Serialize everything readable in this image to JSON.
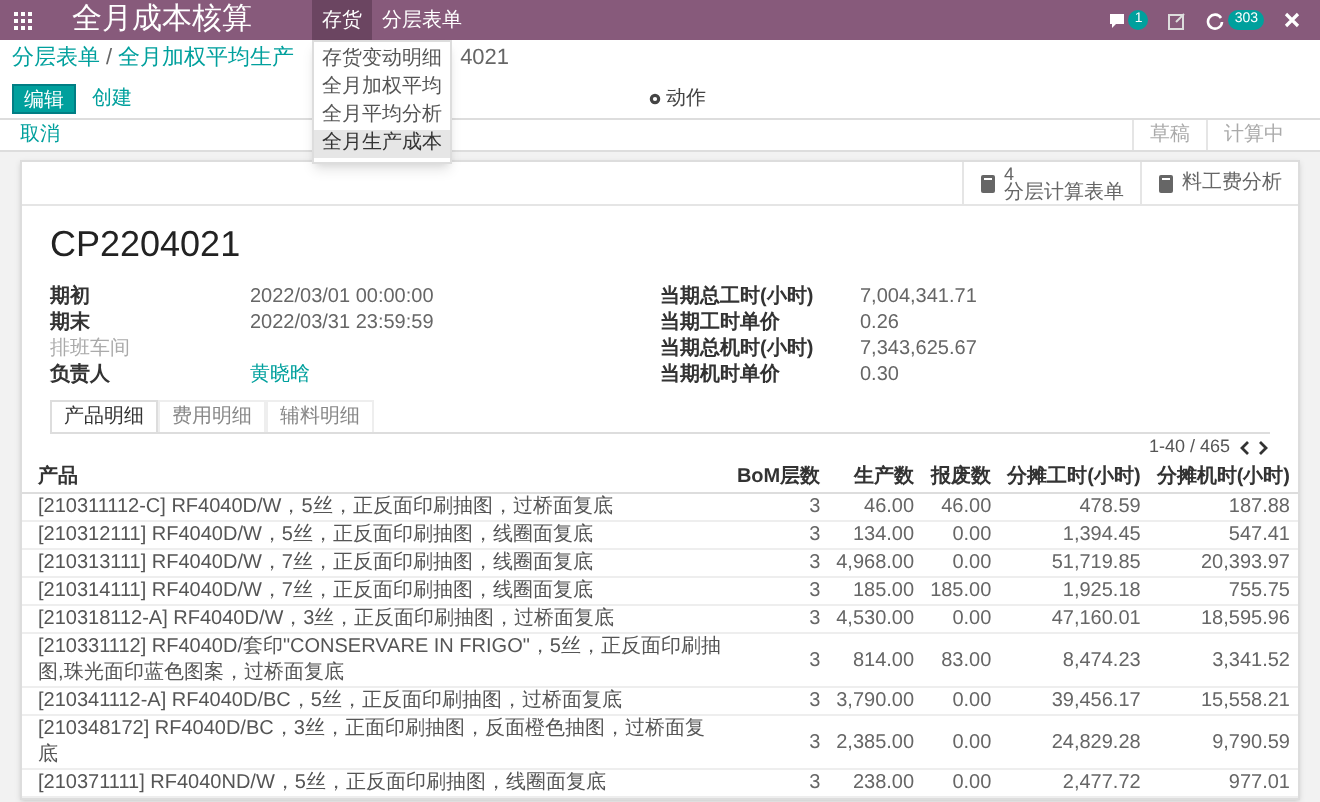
{
  "navbar": {
    "app_title": "全月成本核算",
    "menus": [
      {
        "label": "存货",
        "selected": true
      },
      {
        "label": "分层表单",
        "selected": false
      }
    ],
    "chat_badge": "1",
    "activity_badge": "303"
  },
  "dropdown": {
    "items": [
      {
        "label": "存货变动明细",
        "selected": false
      },
      {
        "label": "全月加权平均",
        "selected": false
      },
      {
        "label": "全月平均分析",
        "selected": false
      },
      {
        "label": "全月生产成本",
        "selected": true
      }
    ]
  },
  "breadcrumb": {
    "parent": "分层表单",
    "separator": "/",
    "current_start": "全月加权平均生产",
    "current_end": "4021"
  },
  "buttons": {
    "edit": "编辑",
    "create": "创建",
    "action": "动作",
    "cancel": "取消"
  },
  "status_bar": [
    {
      "label": "草稿",
      "selected": false
    },
    {
      "label": "计算中",
      "selected": false
    }
  ],
  "smart_buttons": [
    {
      "count": "4",
      "label": "分层计算表单"
    },
    {
      "label": "料工费分析"
    }
  ],
  "title": "CP2204021",
  "fields_left": [
    {
      "label": "期初",
      "value": "2022/03/01 00:00:00",
      "kind": "text"
    },
    {
      "label": "期末",
      "value": "2022/03/31 23:59:59",
      "kind": "text"
    },
    {
      "label": "排班车间",
      "kind": "empty"
    },
    {
      "label": "负责人",
      "value": "黄晓晗",
      "kind": "link"
    }
  ],
  "fields_right": [
    {
      "label": "当期总工时(小时)",
      "value": "7,004,341.71",
      "kind": "text"
    },
    {
      "label": "当期工时单价",
      "value": "0.26",
      "kind": "text"
    },
    {
      "label": "当期总机时(小时)",
      "value": "7,343,625.67",
      "kind": "text"
    },
    {
      "label": "当期机时单价",
      "value": "0.30",
      "kind": "text"
    }
  ],
  "tabs": [
    {
      "label": "产品明细",
      "selected": true
    },
    {
      "label": "费用明细",
      "selected": false
    },
    {
      "label": "辅料明细",
      "selected": false
    }
  ],
  "pager": "1-40 / 465",
  "table": {
    "columns": [
      "产品",
      "BoM层数",
      "生产数",
      "报废数",
      "分摊工时(小时)",
      "分摊机时(小时)"
    ],
    "rows": [
      [
        "[210311112-C] RF4040D/W，5丝，正反面印刷抽图，过桥面复底",
        "3",
        "46.00",
        "46.00",
        "478.59",
        "187.88"
      ],
      [
        "[210312111] RF4040D/W，5丝，正反面印刷抽图，线圈面复底",
        "3",
        "134.00",
        "0.00",
        "1,394.45",
        "547.41"
      ],
      [
        "[210313111] RF4040D/W，7丝，正反面印刷抽图，线圈面复底",
        "3",
        "4,968.00",
        "0.00",
        "51,719.85",
        "20,393.97"
      ],
      [
        "[210314111] RF4040D/W，7丝，正反面印刷抽图，线圈面复底",
        "3",
        "185.00",
        "185.00",
        "1,925.18",
        "755.75"
      ],
      [
        "[210318112-A] RF4040D/W，3丝，正反面印刷抽图，过桥面复底",
        "3",
        "4,530.00",
        "0.00",
        "47,160.01",
        "18,595.96"
      ],
      [
        "[210331112] RF4040D/套印\"CONSERVARE IN FRIGO\"，5丝，正反面印刷抽图,珠光面印蓝色图案，过桥面复底",
        "3",
        "814.00",
        "83.00",
        "8,474.23",
        "3,341.52"
      ],
      [
        "[210341112-A] RF4040D/BC，5丝，正反面印刷抽图，过桥面复底",
        "3",
        "3,790.00",
        "0.00",
        "39,456.17",
        "15,558.21"
      ],
      [
        "[210348172] RF4040D/BC，3丝，正面印刷抽图，反面橙色抽图，过桥面复底",
        "3",
        "2,385.00",
        "0.00",
        "24,829.28",
        "9,790.59"
      ],
      [
        "[210371111] RF4040ND/W，5丝，正反面印刷抽图，线圈面复底",
        "3",
        "238.00",
        "0.00",
        "2,477.72",
        "977.01"
      ]
    ]
  }
}
